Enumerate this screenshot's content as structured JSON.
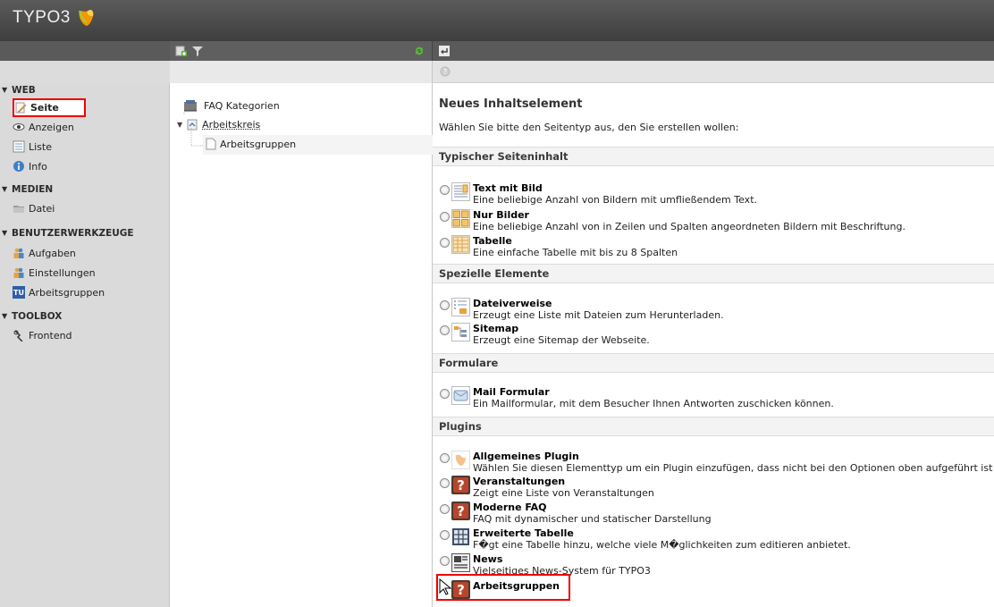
{
  "app": {
    "logo_text": "TYPO3"
  },
  "colors": {
    "topbar": "#4a4a4a",
    "highlight": "#e00000",
    "typo3_orange": "#f49700"
  },
  "modules": [
    {
      "group": "WEB",
      "items": [
        "Seite",
        "Anzeigen",
        "Liste",
        "Info"
      ]
    },
    {
      "group": "MEDIEN",
      "items": [
        "Datei"
      ]
    },
    {
      "group": "BENUTZERWERKZEUGE",
      "items": [
        "Aufgaben",
        "Einstellungen",
        "Arbeitsgruppen"
      ]
    },
    {
      "group": "TOOLBOX",
      "items": [
        "Frontend"
      ]
    }
  ],
  "tree": {
    "nodes": [
      "FAQ Kategorien",
      "Arbeitskreis",
      "Arbeitsgruppen"
    ]
  },
  "content": {
    "title": "Neues Inhaltselement",
    "intro": "Wählen Sie bitte den Seitentyp aus, den Sie erstellen wollen:",
    "sections": [
      {
        "label": "Typischer Seiteninhalt",
        "elements": [
          {
            "title": "Text mit Bild",
            "desc": "Eine beliebige Anzahl von Bildern mit umfließendem Text.",
            "icon": "text-image-icon"
          },
          {
            "title": "Nur Bilder",
            "desc": "Eine beliebige Anzahl von in Zeilen und Spalten angeordneten Bildern mit Beschriftung.",
            "icon": "images-icon"
          },
          {
            "title": "Tabelle",
            "desc": "Eine einfache Tabelle mit bis zu 8 Spalten",
            "icon": "table-icon"
          }
        ]
      },
      {
        "label": "Spezielle Elemente",
        "elements": [
          {
            "title": "Dateiverweise",
            "desc": "Erzeugt eine Liste mit Dateien zum Herunterladen.",
            "icon": "filelinks-icon"
          },
          {
            "title": "Sitemap",
            "desc": "Erzeugt eine Sitemap der Webseite.",
            "icon": "sitemap-icon"
          }
        ]
      },
      {
        "label": "Formulare",
        "elements": [
          {
            "title": "Mail Formular",
            "desc": "Ein Mailformular, mit dem Besucher Ihnen Antworten zuschicken können.",
            "icon": "mailform-icon"
          }
        ]
      },
      {
        "label": "Plugins",
        "elements": [
          {
            "title": "Allgemeines Plugin",
            "desc": "Wählen Sie diesen Elementtyp um ein Plugin einzufügen, dass nicht bei den Optionen oben aufgeführt ist",
            "icon": "plugin-icon"
          },
          {
            "title": "Veranstaltungen",
            "desc": "Zeigt eine Liste von Veranstaltungen",
            "icon": "question-icon"
          },
          {
            "title": "Moderne FAQ",
            "desc": "FAQ mit dynamischer und statischer Darstellung",
            "icon": "question-icon"
          },
          {
            "title": "Erweiterte Tabelle",
            "desc": "F�gt eine Tabelle hinzu, welche viele M�glichkeiten zum editieren anbietet.",
            "icon": "table-grid-icon"
          },
          {
            "title": "News",
            "desc": "Vielseitiges News-System für TYPO3",
            "icon": "news-icon"
          },
          {
            "title": "Arbeitsgruppen",
            "desc": "",
            "icon": "question-icon"
          }
        ]
      }
    ]
  }
}
